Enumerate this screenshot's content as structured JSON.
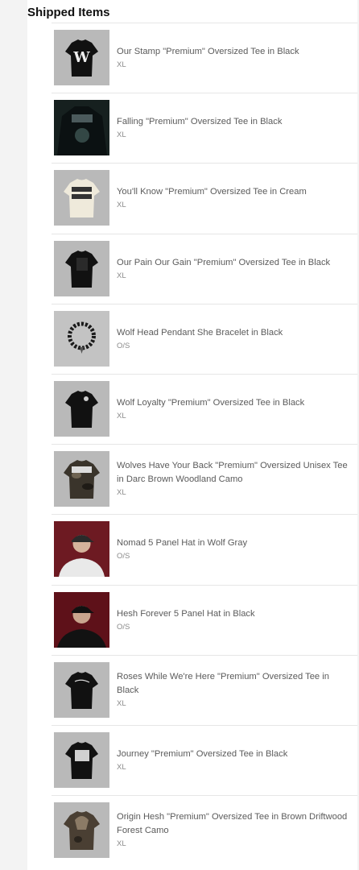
{
  "section": {
    "title": "Shipped Items"
  },
  "items": [
    {
      "name": "Our Stamp \"Premium\" Oversized Tee in Black",
      "size": "XL",
      "icon": "tshirt-black-icon"
    },
    {
      "name": "Falling \"Premium\" Oversized Tee in Black",
      "size": "XL",
      "icon": "tshirt-photo-icon"
    },
    {
      "name": "You'll Know \"Premium\" Oversized Tee in Cream",
      "size": "XL",
      "icon": "tshirt-cream-icon"
    },
    {
      "name": "Our Pain Our Gain \"Premium\" Oversized Tee in Black",
      "size": "XL",
      "icon": "tshirt-black-icon"
    },
    {
      "name": "Wolf Head Pendant She Bracelet in Black",
      "size": "O/S",
      "icon": "bracelet-icon"
    },
    {
      "name": "Wolf Loyalty \"Premium\" Oversized Tee in Black",
      "size": "XL",
      "icon": "tshirt-black-icon"
    },
    {
      "name": "Wolves Have Your Back \"Premium\" Oversized Unisex Tee in Darc Brown Woodland Camo",
      "size": "XL",
      "icon": "tshirt-camo-icon"
    },
    {
      "name": "Nomad 5 Panel Hat in Wolf Gray",
      "size": "O/S",
      "icon": "hat-model-icon"
    },
    {
      "name": "Hesh Forever 5 Panel Hat in Black",
      "size": "O/S",
      "icon": "hat-model-icon"
    },
    {
      "name": "Roses While We're Here \"Premium\" Oversized Tee in Black",
      "size": "XL",
      "icon": "tshirt-black-icon"
    },
    {
      "name": "Journey \"Premium\" Oversized Tee in Black",
      "size": "XL",
      "icon": "tshirt-black-icon"
    },
    {
      "name": "Origin Hesh \"Premium\" Oversized Tee in Brown Driftwood Forest Camo",
      "size": "XL",
      "icon": "tshirt-camo-icon"
    }
  ]
}
